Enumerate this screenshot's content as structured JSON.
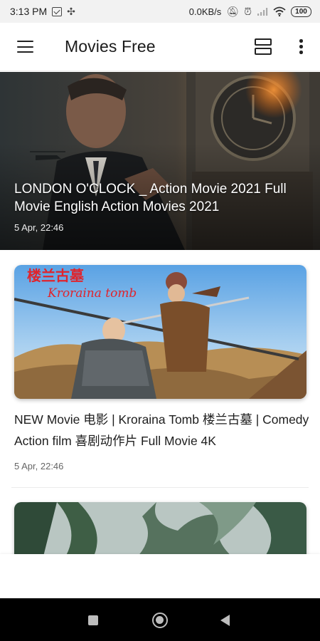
{
  "status_bar": {
    "time": "3:13 PM",
    "speed": "0.0KB/s",
    "battery": "100",
    "icons": [
      "notification-icon",
      "fan-icon",
      "mute-icon",
      "alarm-icon",
      "signal-icon",
      "wifi-icon",
      "battery-icon"
    ]
  },
  "app_bar": {
    "title": "Movies Free",
    "icons": [
      "menu-icon",
      "layout-toggle-icon",
      "more-vert-icon"
    ]
  },
  "feed": {
    "hero": {
      "title": "LONDON O'CLOCK _ Action Movie 2021 Full Movie English Action Movies 2021",
      "date": "5 Apr, 22:46"
    },
    "items": [
      {
        "title": "NEW Movie 电影 | Kroraina Tomb 楼兰古墓 | Comedy Action film 喜剧动作片 Full Movie 4K",
        "date": "5 Apr, 22:46",
        "thumb_caption_cn": "楼兰古墓",
        "thumb_caption": "Kroraina tomb"
      },
      {
        "title": "",
        "date": ""
      }
    ]
  },
  "nav_bar": {
    "buttons": [
      "recents-button",
      "home-button",
      "back-button"
    ]
  },
  "colors": {
    "accent_text": "#1e1e1e",
    "status_bg": "#f2f2f2",
    "nav_bg": "#000000"
  }
}
